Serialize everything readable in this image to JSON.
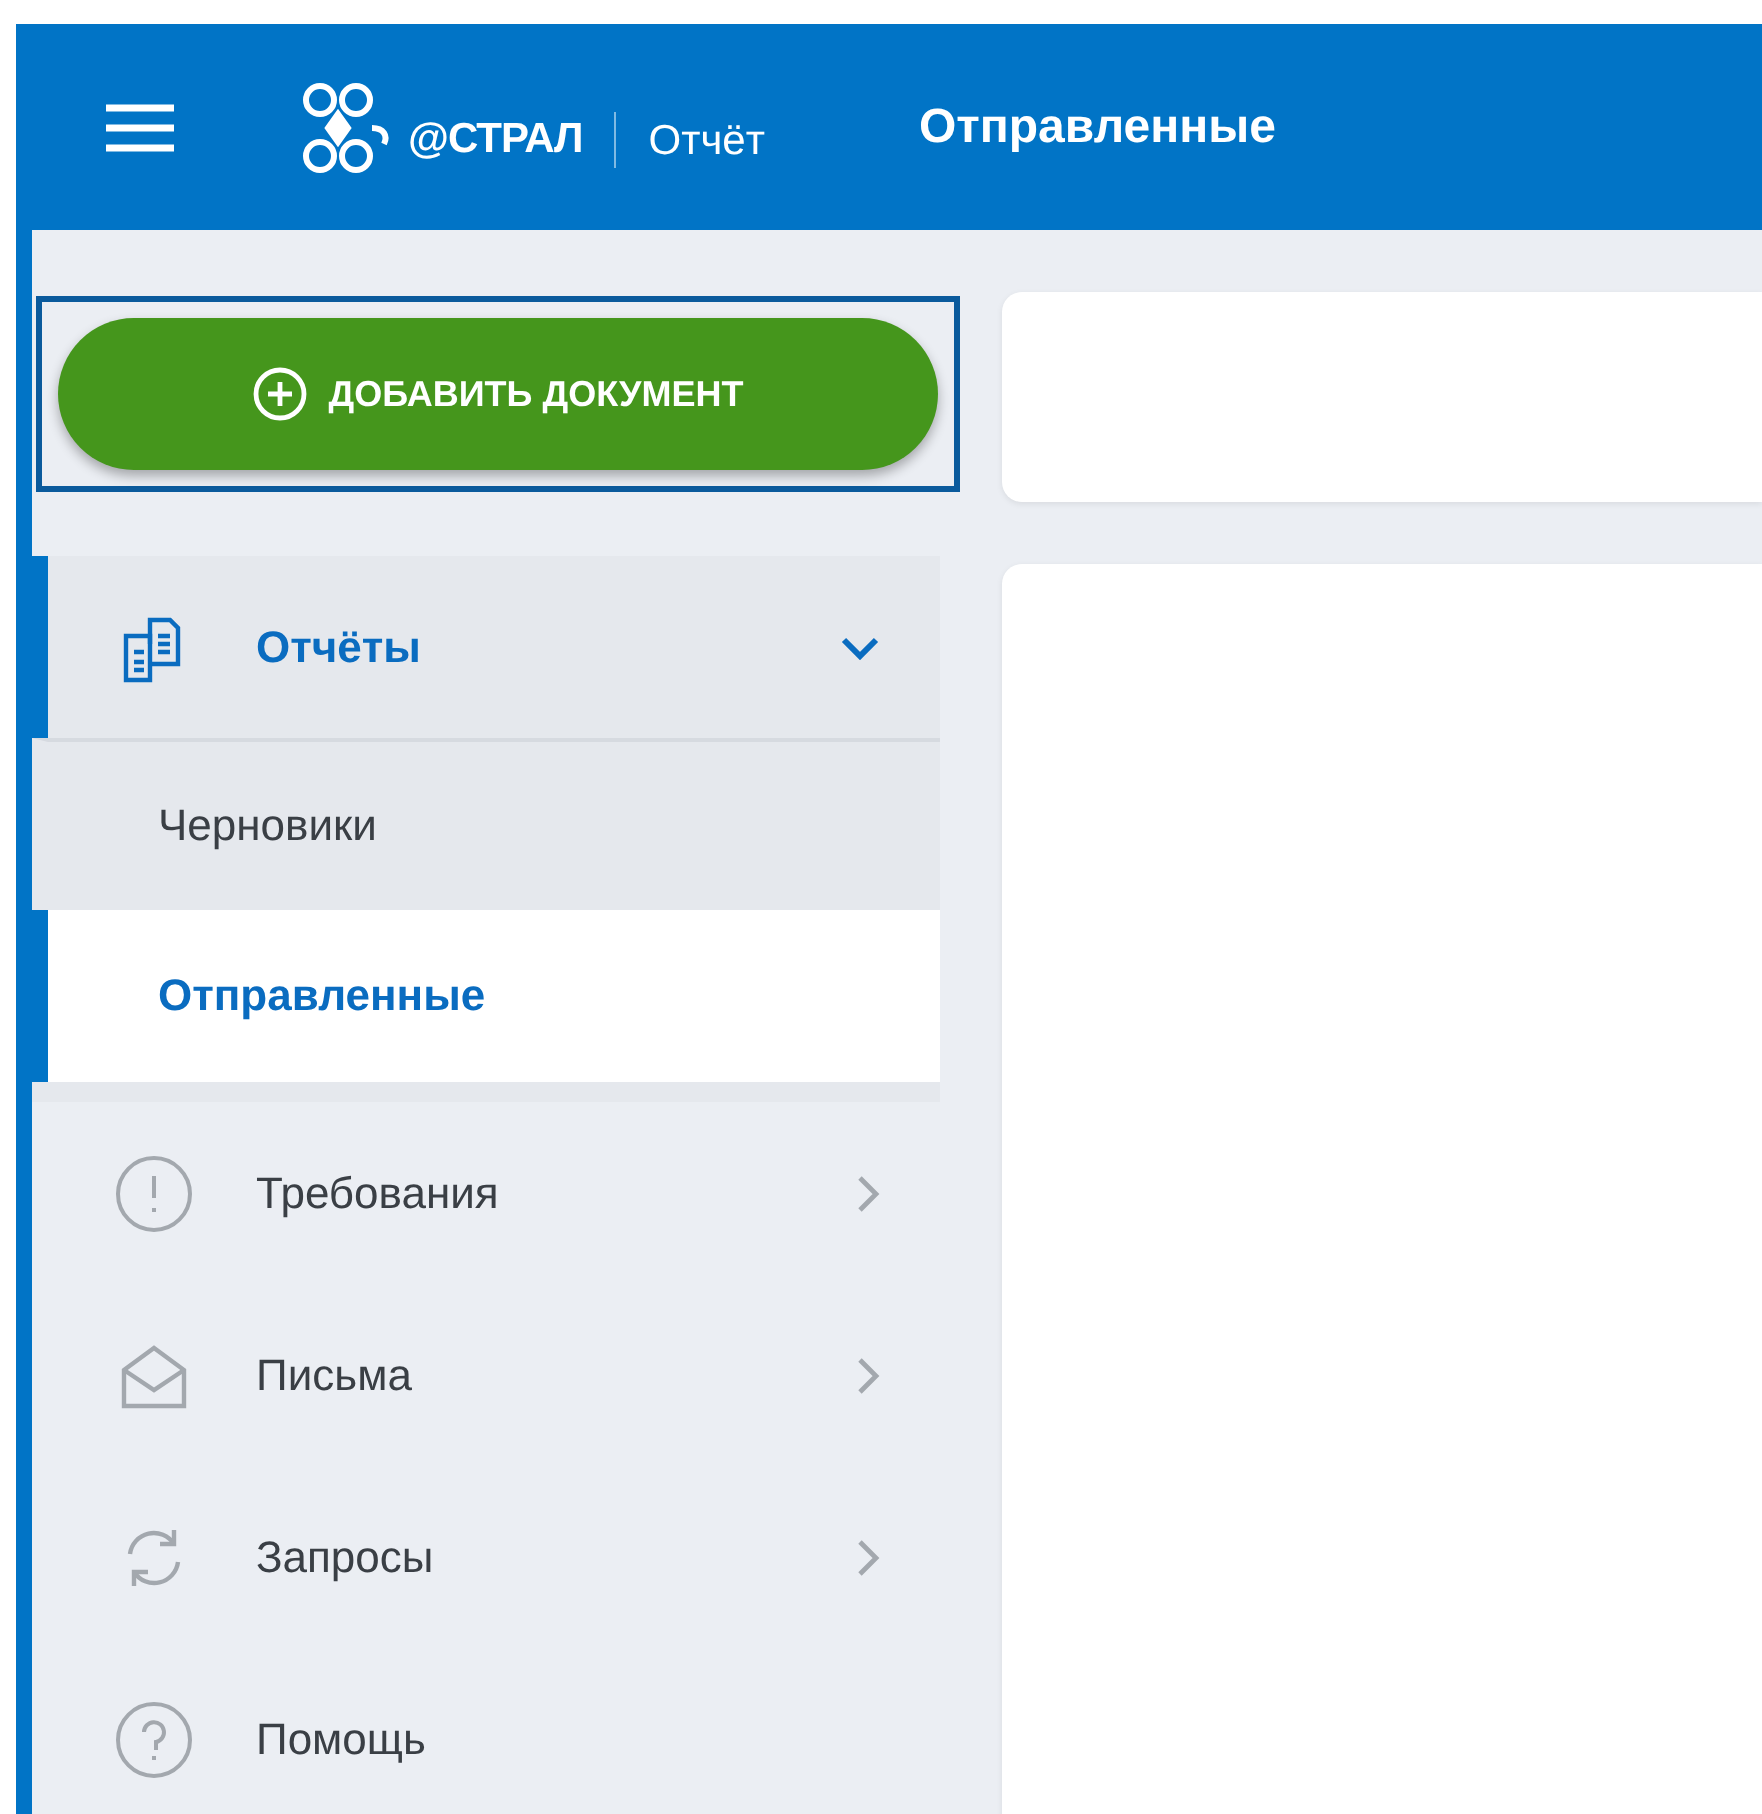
{
  "header": {
    "logo_text": "@СТРАЛ",
    "product": "Отчёт",
    "page_title": "Отправленные"
  },
  "add_button": {
    "label": "ДОБАВИТЬ ДОКУМЕНТ",
    "focused": true
  },
  "nav": [
    {
      "kind": "group",
      "label": "Отчёты",
      "active": true,
      "expanded": true,
      "children": [
        {
          "label": "Черновики",
          "selected": false
        },
        {
          "label": "Отправленные",
          "selected": true
        }
      ]
    },
    {
      "kind": "group",
      "label": "Требования",
      "active": false,
      "expanded": false
    },
    {
      "kind": "group",
      "label": "Письма",
      "active": false,
      "expanded": false
    },
    {
      "kind": "group",
      "label": "Запросы",
      "active": false,
      "expanded": false
    },
    {
      "kind": "link",
      "label": "Помощь",
      "active": false
    }
  ]
}
